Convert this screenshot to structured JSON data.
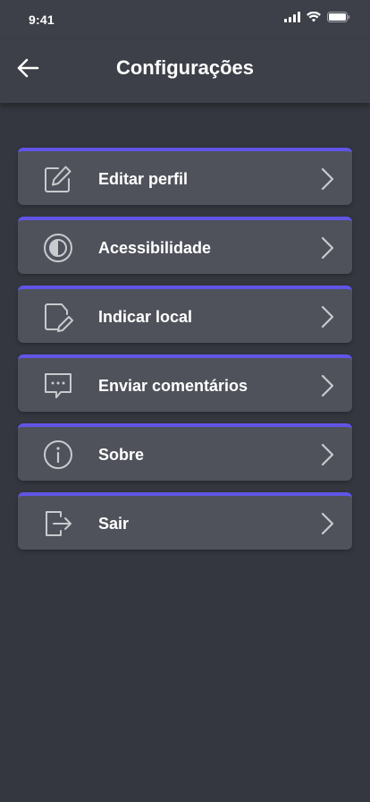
{
  "status_bar": {
    "time": "9:41"
  },
  "header": {
    "title": "Configurações"
  },
  "menu": {
    "items": [
      {
        "label": "Editar perfil",
        "icon": "edit-icon"
      },
      {
        "label": "Acessibilidade",
        "icon": "contrast-icon"
      },
      {
        "label": "Indicar local",
        "icon": "note-edit-icon"
      },
      {
        "label": "Enviar comentários",
        "icon": "feedback-message-icon"
      },
      {
        "label": "Sobre",
        "icon": "info-icon"
      },
      {
        "label": "Sair",
        "icon": "logout-icon"
      }
    ]
  },
  "colors": {
    "background": "#34373f",
    "header": "#3d4048",
    "card": "#4f525b",
    "accent": "#6155e6",
    "icon": "#c9cace"
  }
}
